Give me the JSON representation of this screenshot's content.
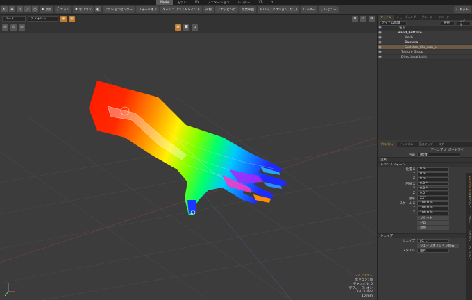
{
  "top_tabs": [
    "Modo",
    "モデル",
    "UV",
    "アニメーション",
    "レンダー",
    "VR",
    "+"
  ],
  "top_active": "Modo",
  "toolbar": {
    "vertex": "頂点",
    "edge": "エッジ",
    "polygon": "ポリゴン",
    "action_center": "アクションセンター",
    "falloff": "フォールオフ",
    "mesh_constraint": "メッシュコンストレイント",
    "symmetry": "対称",
    "snapping": "スナッピング",
    "workplane": "作業平面",
    "drop_action": "ドロップアクション (なし)",
    "render": "レンダー",
    "preview": "プレビュー",
    "kit": "キット"
  },
  "viewport": {
    "view_mode": "パース",
    "shading": "デフォルト",
    "stats": {
      "items": "22 アイテム",
      "polygons": "ポリゴン: 面",
      "channels": "チャンネル: 0",
      "deformers": "デフォーマ: オン",
      "gl": "GL: 1,472",
      "size": "10 mm"
    }
  },
  "items_panel": {
    "tabs": [
      "アイテム",
      "シェーディング",
      "グループ",
      "イメージ"
    ],
    "item_list_label": "アイテム階層",
    "buttons": {
      "select": "選択",
      "filter": "フィル"
    },
    "header_name": "名前",
    "items": [
      {
        "name": "Hand_Left.lxo",
        "indent": 0,
        "selected": false,
        "bold": true
      },
      {
        "name": "Mesh",
        "indent": 2,
        "selected": false,
        "bold": false
      },
      {
        "name": "Camera",
        "indent": 2,
        "selected": false,
        "bold": true
      },
      {
        "name": "Skeleton_Chr_Arm_L",
        "indent": 2,
        "selected": true,
        "bold": false
      },
      {
        "name": "Texture Group",
        "indent": 1,
        "selected": false,
        "bold": false
      },
      {
        "name": "Directional Light",
        "indent": 1,
        "selected": false,
        "bold": false
      }
    ]
  },
  "props_panel": {
    "tabs": [
      "プロパティ",
      "チャンネル",
      "頂点マップ",
      "ログ"
    ],
    "assembly": "アセンブリ",
    "preset": "ポートアイ",
    "name_label": "名前",
    "name_value": "(複数)",
    "sections": {
      "notes": "注釈",
      "transform": "トランスフォーム",
      "shape": "シェイプ"
    },
    "position_label": "位置",
    "rotation_label": "回転",
    "order_label": "順序",
    "scale_label": "スケール",
    "position": [
      "0 m",
      "0 m",
      "0 m"
    ],
    "rotation": [
      "0.0 °",
      "0.0 °",
      "0.0 °"
    ],
    "order": "ZXY",
    "scale": [
      "100.0 %",
      "100.0 %",
      "100.0 %"
    ],
    "axes": [
      "X",
      "Y",
      "Z"
    ],
    "buttons": [
      "リセット",
      "ゼロ",
      "追加"
    ],
    "shape_label": "シェイプ",
    "shape_value": "(なし)",
    "shape_option_button": "シェイプオプション除去",
    "style_label": "スタイル",
    "style_value": "面有"
  },
  "side_tabs": [
    "モデルプロパティ",
    "テクスチャ",
    "ブラシ",
    "シェイプ",
    "プロパティ"
  ],
  "colors": {
    "accent": "#e6a13a",
    "selected": "#6b5a45"
  }
}
